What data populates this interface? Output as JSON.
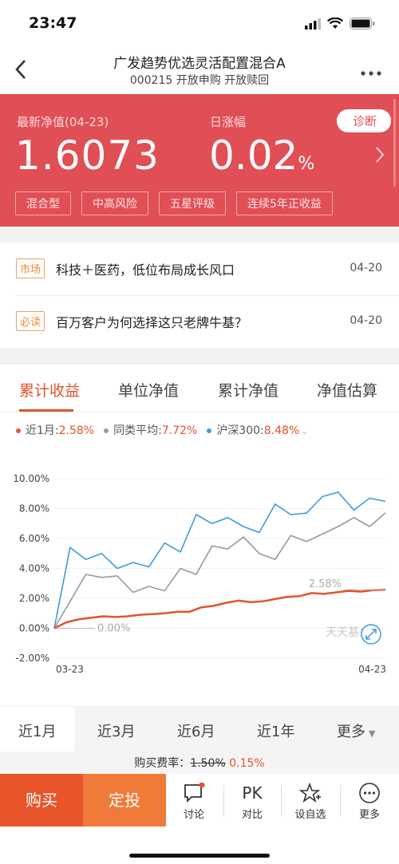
{
  "status_bar": {
    "time": "23:47"
  },
  "header": {
    "title": "广发趋势优选灵活配置混合A",
    "subtitle": "000215 开放申购 开放赎回"
  },
  "hero": {
    "nav_label": "最新净值(04-23)",
    "nav_value": "1.6073",
    "change_label": "日涨幅",
    "change_value": "0.02",
    "change_unit": "%",
    "diagnose_button": "诊断",
    "tags": [
      "混合型",
      "中高风险",
      "五星评级",
      "连续5年正收益"
    ],
    "colors": {
      "background": "#e04f55"
    }
  },
  "news": [
    {
      "badge": "市场",
      "text": "科技＋医药，低位布局成长风口",
      "date": "04-20"
    },
    {
      "badge": "必读",
      "text": "百万客户为何选择这只老牌牛基？",
      "date": "04-20"
    }
  ],
  "chart_tabs": [
    "累计收益",
    "单位净值",
    "累计净值",
    "净值估算"
  ],
  "legend": [
    {
      "label": "近1月:",
      "value": "2.58%",
      "color": "#e2542d"
    },
    {
      "label": "同类平均:",
      "value": "7.72%",
      "color": "#999999"
    },
    {
      "label": "沪深300:",
      "value": "8.48%",
      "color": "#3d9be0"
    }
  ],
  "chart_data": {
    "type": "line",
    "ylim": [
      -2,
      10
    ],
    "y_ticks": [
      "10.00%",
      "8.00%",
      "6.00%",
      "4.00%",
      "2.00%",
      "0.00%",
      "-2.00%"
    ],
    "x_labels": [
      "03-23",
      "04-23"
    ],
    "annotations": [
      "0.00%",
      "2.58%"
    ],
    "watermark": "天天基金",
    "series": [
      {
        "color": "#e2542d",
        "values": [
          0,
          0.4,
          0.6,
          0.7,
          0.8,
          0.75,
          0.8,
          0.9,
          0.95,
          1.0,
          1.1,
          1.1,
          1.4,
          1.5,
          1.7,
          1.85,
          1.75,
          1.8,
          1.95,
          2.1,
          2.15,
          2.35,
          2.3,
          2.4,
          2.5,
          2.45,
          2.55,
          2.58
        ]
      },
      {
        "color": "#999999",
        "values": [
          0,
          1.8,
          3.6,
          3.4,
          3.5,
          2.4,
          2.8,
          2.5,
          4.0,
          3.6,
          5.5,
          5.3,
          6.1,
          5.0,
          4.6,
          6.2,
          5.8,
          6.3,
          6.8,
          7.4,
          6.8,
          7.72
        ]
      },
      {
        "color": "#3d9be0",
        "values": [
          0,
          5.4,
          4.6,
          5.0,
          4.0,
          4.4,
          4.1,
          5.7,
          5.1,
          7.6,
          7.0,
          7.4,
          6.8,
          6.4,
          8.3,
          7.6,
          7.7,
          8.8,
          9.1,
          7.9,
          8.7,
          8.48
        ]
      }
    ]
  },
  "range_options": [
    "近1月",
    "近3月",
    "近6月",
    "近1年",
    "更多"
  ],
  "fee": {
    "label": "购买费率：",
    "original": "1.50%",
    "current": "0.15%"
  },
  "bottom_bar": {
    "buy": "购买",
    "fixed_invest": "定投",
    "items": [
      "讨论",
      "对比",
      "设自选",
      "更多"
    ]
  }
}
